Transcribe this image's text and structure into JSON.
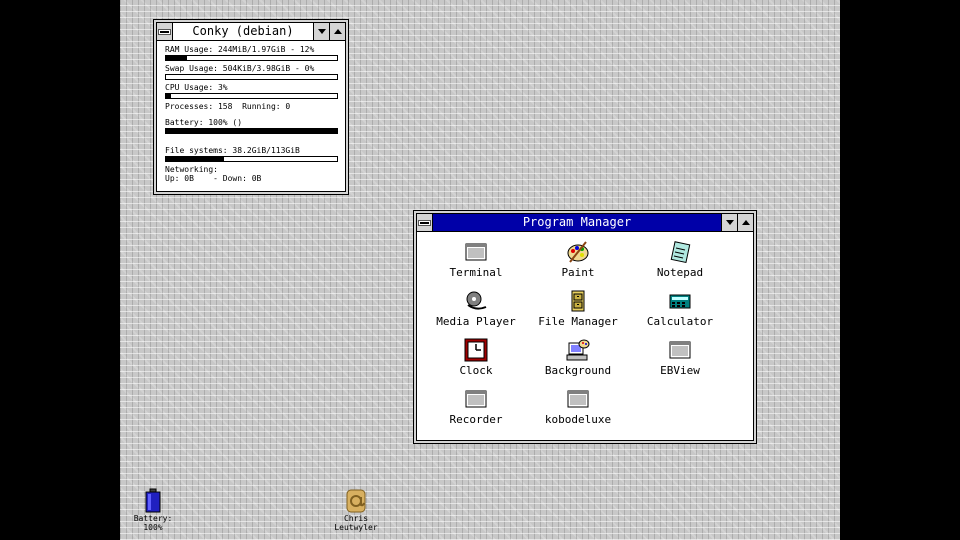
{
  "conky": {
    "title": "Conky (debian)",
    "ram": {
      "label": "RAM Usage: 244MiB/1.97GiB - 12%",
      "fraction": 0.12
    },
    "swap": {
      "label": "Swap Usage: 504KiB/3.98GiB - 0%",
      "fraction": 0.0
    },
    "cpu": {
      "label": "CPU Usage: 3%",
      "fraction": 0.03
    },
    "processes": "Processes: 158  Running: 0",
    "battery": {
      "label": "Battery: 100% ()",
      "fraction": 1.0
    },
    "filesystems": {
      "label": "File systems: 38.2GiB/113GiB",
      "fraction": 0.34
    },
    "networking": "Networking:",
    "net_line": "Up: 0B    - Down: 0B"
  },
  "progman": {
    "title": "Program Manager",
    "icons": [
      {
        "label": "Terminal",
        "icon": "window-icon"
      },
      {
        "label": "Paint",
        "icon": "palette-icon"
      },
      {
        "label": "Notepad",
        "icon": "notepad-icon"
      },
      {
        "label": "Media Player",
        "icon": "film-reel-icon"
      },
      {
        "label": "File Manager",
        "icon": "file-cabinet-icon"
      },
      {
        "label": "Calculator",
        "icon": "calculator-icon"
      },
      {
        "label": "Clock",
        "icon": "clock-icon"
      },
      {
        "label": "Background",
        "icon": "computer-palette-icon"
      },
      {
        "label": "EBView",
        "icon": "window-icon"
      },
      {
        "label": "Recorder",
        "icon": "window-icon"
      },
      {
        "label": "kobodeluxe",
        "icon": "window-icon"
      }
    ]
  },
  "desktop": {
    "battery": {
      "label": "Battery:\n100%"
    },
    "user": {
      "label": "Chris\nLeutwyler"
    }
  },
  "colors": {
    "active_title": "#0000a8",
    "desktop": "#c8c8c8"
  }
}
